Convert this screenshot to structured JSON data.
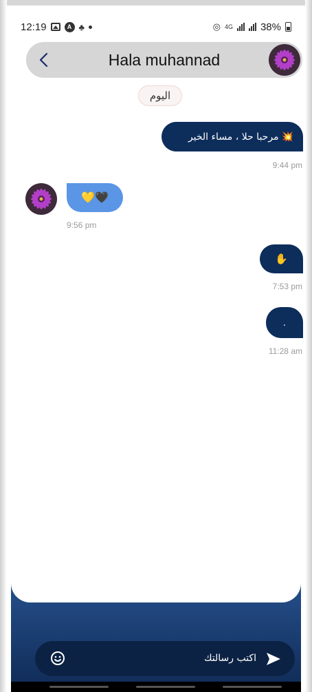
{
  "status_bar": {
    "time": "12:19",
    "signal_label": "4G",
    "battery": "38%"
  },
  "header": {
    "contact_name": "Hala muhannad"
  },
  "day_label": "اليوم",
  "messages": [
    {
      "direction": "outgoing",
      "text": "مرحبا حلا ، مساء الخير",
      "emoji": "💥",
      "time": "9:44 pm"
    },
    {
      "direction": "incoming",
      "emoji": "💛🖤",
      "time": "9:56 pm"
    },
    {
      "direction": "outgoing",
      "emoji": "✋",
      "time": "7:53 pm"
    },
    {
      "direction": "outgoing",
      "text": ".",
      "time": "11:28 am"
    }
  ],
  "composer": {
    "placeholder": "اكتب رسالتك"
  },
  "colors": {
    "outgoing_bubble": "#0d2d5b",
    "incoming_bubble": "#5a95e6",
    "header_bg": "#d6d6d6",
    "composer_bg": "#0c2244"
  },
  "icons": {
    "back": "chevron-left-icon",
    "emoji": "smiley-icon",
    "send": "send-icon"
  }
}
